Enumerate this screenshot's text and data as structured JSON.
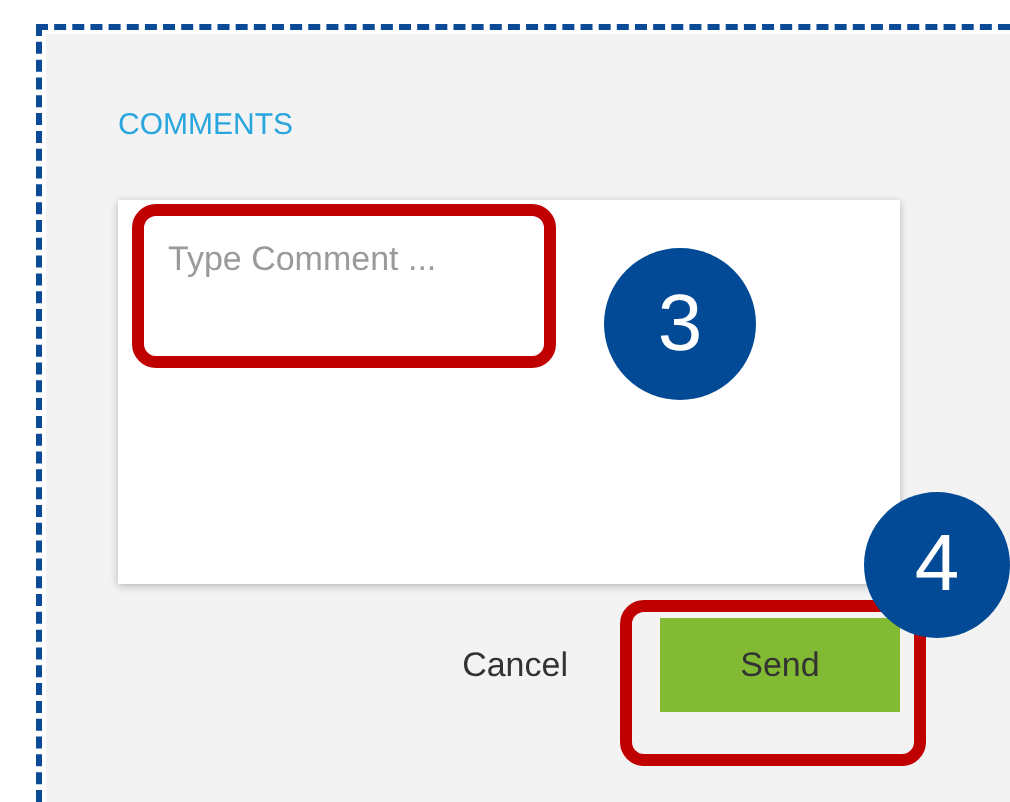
{
  "section_title": "COMMENTS",
  "comment_field": {
    "placeholder": "Type Comment ..."
  },
  "buttons": [
    {
      "label": "Cancel",
      "kind": "text"
    },
    {
      "label": "Send",
      "kind": "primary"
    }
  ],
  "callouts": [
    {
      "number": "3"
    },
    {
      "number": "4"
    }
  ]
}
